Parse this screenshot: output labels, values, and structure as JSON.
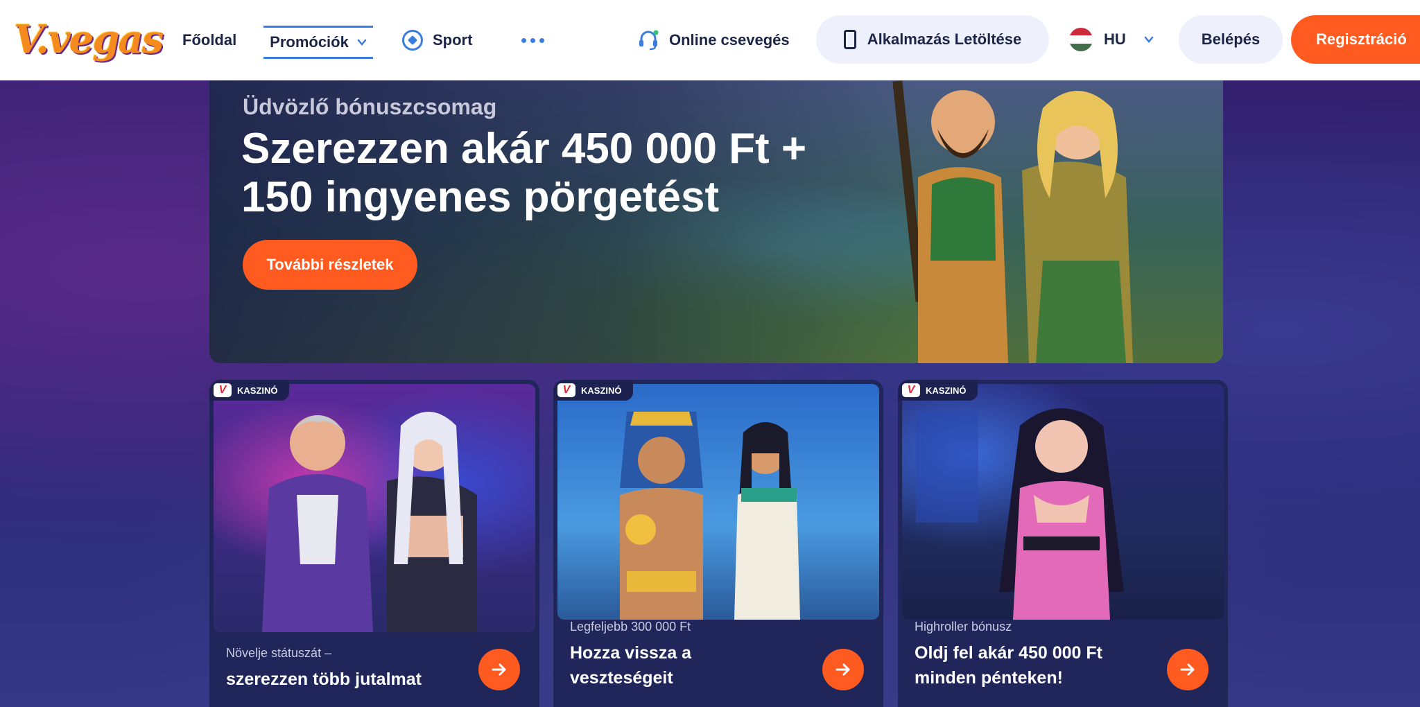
{
  "header": {
    "logo_text": "V.vegas",
    "nav": {
      "home": "Főoldal",
      "promotions": "Promóciók",
      "sport": "Sport",
      "chat": "Online csevegés"
    },
    "app_download": "Alkalmazás Letöltése",
    "language": "HU",
    "login": "Belépés",
    "register": "Regisztráció"
  },
  "hero": {
    "subtitle": "Üdvözlő bónuszcsomag",
    "title_line1": "Szerezzen akár 450 000 Ft +",
    "title_line2": "150 ingyenes pörgetést",
    "cta": "További részletek"
  },
  "cards": [
    {
      "badge": "KASZINÓ",
      "small": "Növelje státuszát –",
      "big": "szerezzen több jutalmat"
    },
    {
      "badge": "KASZINÓ",
      "small": "Legfeljebb 300 000 Ft",
      "big": "Hozza vissza a veszteségeit"
    },
    {
      "badge": "KASZINÓ",
      "small": "Highroller bónusz",
      "big": "Oldj fel akár 450 000 Ft minden pénteken!"
    }
  ],
  "colors": {
    "accent_orange": "#ff5a1f",
    "nav_blue": "#3a7de0",
    "text_dark": "#1d2547",
    "card_bg": "#20255a"
  },
  "icons": {
    "promo_chevron": "chevron-down-icon",
    "sport": "soccer-ball-icon",
    "more": "more-dots-icon",
    "chat": "headset-icon",
    "app": "phone-icon",
    "language_flag": "hungary-flag-icon",
    "language_chevron": "chevron-down-icon",
    "card_arrow": "arrow-right-icon"
  }
}
